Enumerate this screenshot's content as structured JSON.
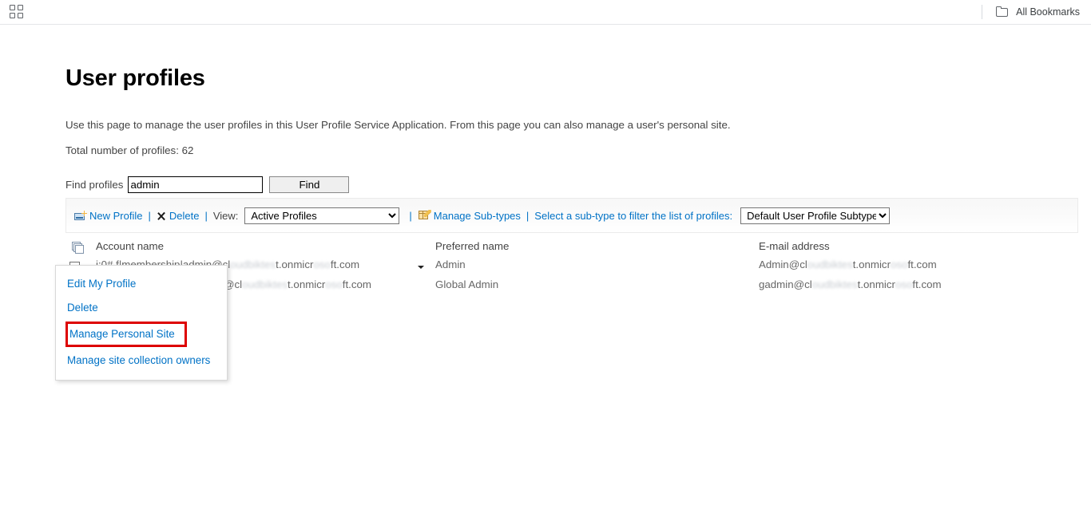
{
  "browser": {
    "apps_icon": "apps-grid-icon",
    "bookmarks_folder_icon": "folder-icon",
    "all_bookmarks_label": "All Bookmarks"
  },
  "page": {
    "title": "User profiles",
    "description": "Use this page to manage the user profiles in this User Profile Service Application. From this page you can also manage a user's personal site.",
    "total_profiles": "Total number of profiles: 62"
  },
  "find": {
    "label": "Find profiles",
    "value": "admin",
    "placeholder": "",
    "button_label": "Find"
  },
  "toolbar": {
    "new_profile_label": "New Profile",
    "new_profile_icon": "new-profile-icon",
    "separator": "|",
    "delete_label": "Delete",
    "delete_icon": "delete-x-icon",
    "view_label": "View:",
    "view_selected": "Active Profiles",
    "view_options": [
      "Active Profiles"
    ],
    "manage_subtypes_label": "Manage Sub-types",
    "manage_subtypes_icon": "subtypes-pencil-icon",
    "subtype_filter_label": "Select a sub-type to filter the list of profiles:",
    "subtype_selected": "Default User Profile Subtype",
    "subtype_options": [
      "Default User Profile Subtype"
    ]
  },
  "table": {
    "header_icon": "pages-stack-icon",
    "columns": [
      "Account name",
      "Preferred name",
      "E-mail address"
    ],
    "rows": [
      {
        "account_name_visible": "i:0#.f|membership|admin@cl",
        "account_name_blurred": "oudbiktes",
        "account_name_tail": "t.onmicr",
        "account_name_blurred2": "oso",
        "account_name_end": "ft.com",
        "preferred_name": "Admin",
        "email_visible": "Admin@cl",
        "email_blurred": "oudbiktes",
        "email_tail": "t.onmicr",
        "email_blurred2": "oso",
        "email_end": "ft.com"
      },
      {
        "account_name_visible": "",
        "account_name_blurred": "",
        "account_name_tail": "@cl",
        "account_name_blurred2": "oudbiktes",
        "account_name_end": "t.onmicr",
        "account_name_end2": "oso",
        "account_name_end3": "ft.com",
        "preferred_name": "Global Admin",
        "email_visible": "gadmin@cl",
        "email_blurred": "oudbiktes",
        "email_tail": "t.onmicr",
        "email_blurred2": "oso",
        "email_end": "ft.com"
      }
    ]
  },
  "context_menu": {
    "items": [
      {
        "label": "Edit My Profile",
        "highlighted": false
      },
      {
        "label": "Delete",
        "highlighted": false
      },
      {
        "label": "Manage Personal Site",
        "highlighted": true
      },
      {
        "label": "Manage site collection owners",
        "highlighted": false
      }
    ],
    "highlight_color": "#dd0000"
  },
  "colors": {
    "link": "#0072c6",
    "text": "#444444",
    "muted": "#666666",
    "highlight": "#dd0000"
  }
}
